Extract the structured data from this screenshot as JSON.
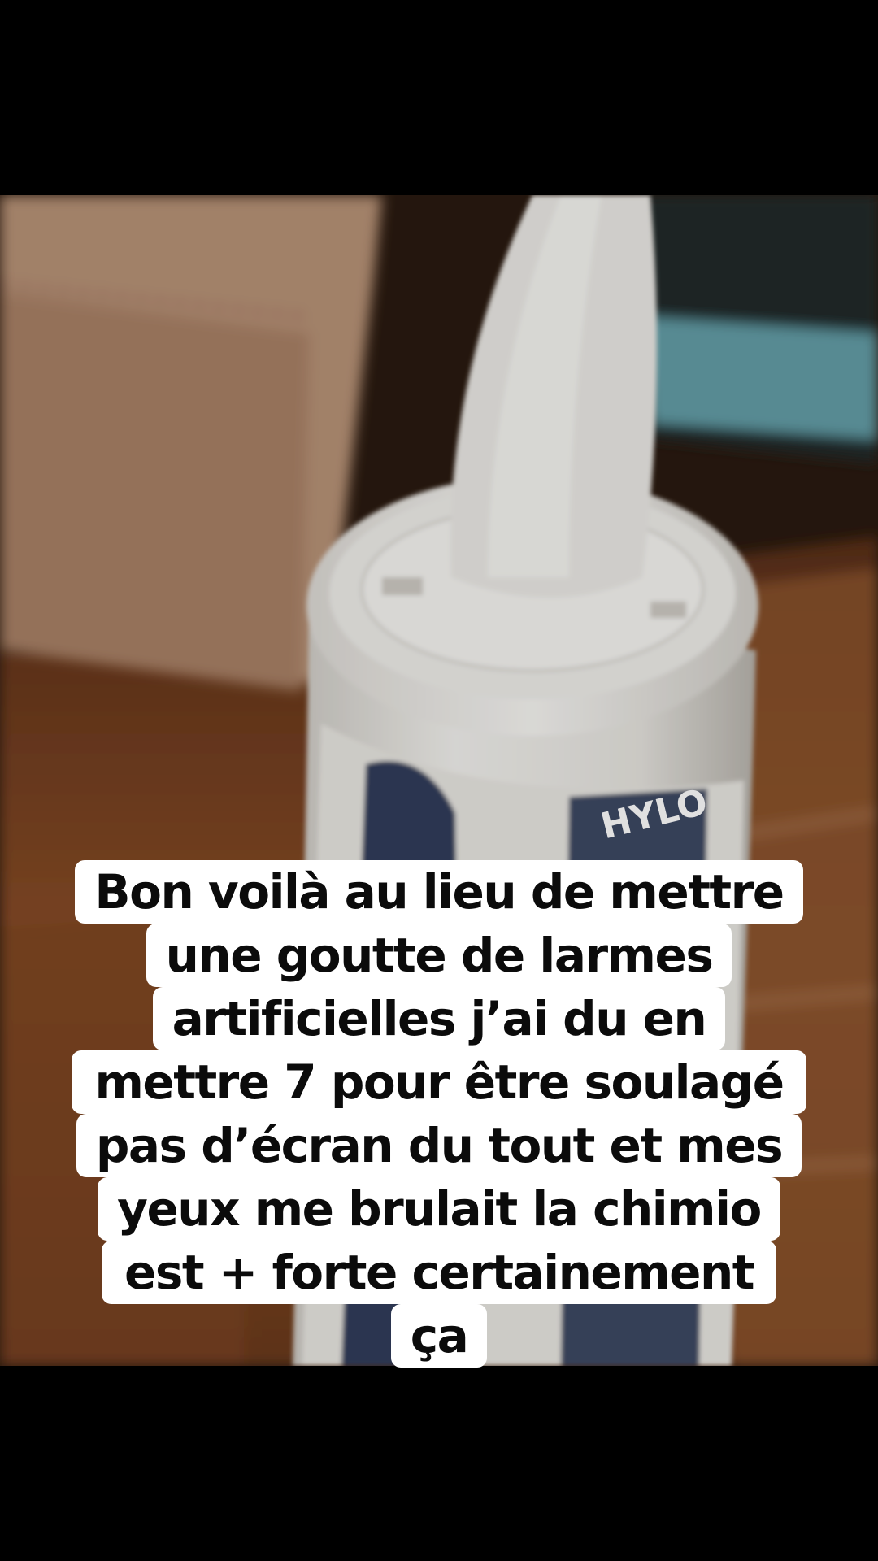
{
  "photo": {
    "subject": "bottle-with-dropper-tip",
    "label_text": "HYLO",
    "colors": {
      "wood": "#7a4322",
      "wood_dark": "#3e2113",
      "box": "#b89377",
      "bottle": "#ecebe6",
      "label_blue": "#1f2b4e",
      "teal_item": "#6fb3bd"
    }
  },
  "caption": {
    "lines": [
      "Bon voilà au lieu de mettre",
      "une goutte de larmes",
      "artificielles j’ai du en",
      "mettre 7 pour être soulagé",
      "pas d’écran du tout et mes",
      "yeux me brulait la chimio",
      "est + forte certainement",
      "ça"
    ]
  }
}
